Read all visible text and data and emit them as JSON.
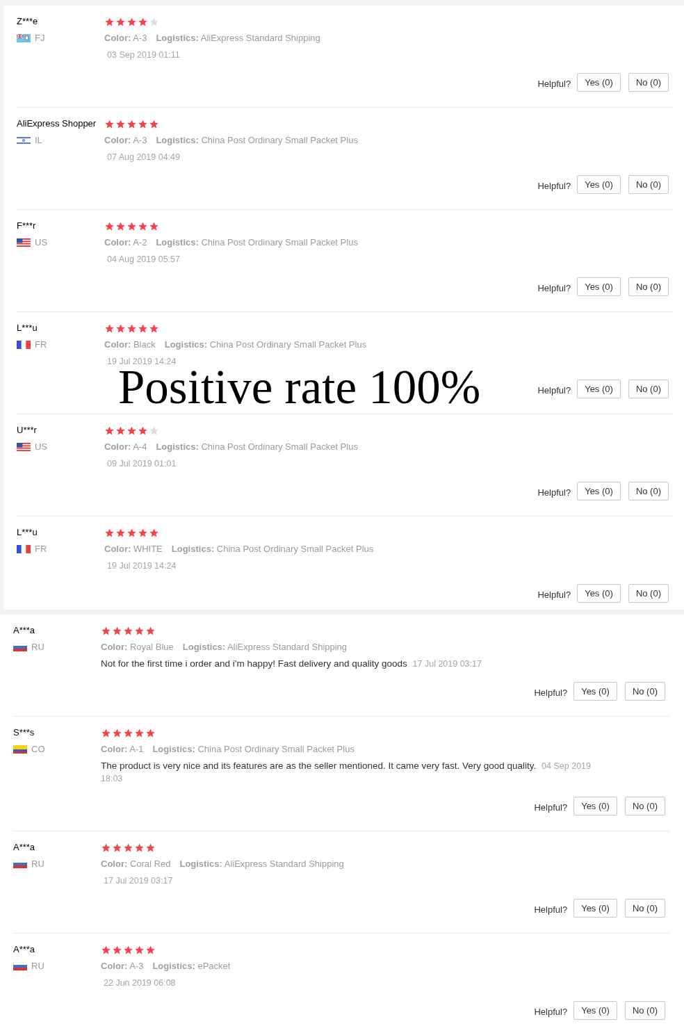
{
  "panels": [
    {
      "reviews": [
        {
          "name": "Z***e",
          "country": "FJ",
          "flag": {
            "kind": "fiji"
          },
          "stars": 4,
          "color_label": "Color:",
          "color_value": "A-3",
          "logistics_label": "Logistics:",
          "logistics_value": "AliExpress Standard Shipping",
          "date": "03 Sep 2019 01:11",
          "helpful_label": "Helpful?",
          "yes_button": "Yes (0)",
          "no_button": "No (0)"
        },
        {
          "name": "AliExpress Shopper",
          "country": "IL",
          "flag": {
            "kind": "israel"
          },
          "stars": 5,
          "color_label": "Color:",
          "color_value": "A-3",
          "logistics_label": "Logistics:",
          "logistics_value": "China Post Ordinary Small Packet Plus",
          "date": "07 Aug 2019 04:49",
          "helpful_label": "Helpful?",
          "yes_button": "Yes (0)",
          "no_button": "No (0)"
        },
        {
          "name": "F***r",
          "country": "US",
          "flag": {
            "kind": "usa"
          },
          "stars": 5,
          "color_label": "Color:",
          "color_value": "A-2",
          "logistics_label": "Logistics:",
          "logistics_value": "China Post Ordinary Small Packet Plus",
          "date": "04 Aug 2019 05:57",
          "helpful_label": "Helpful?",
          "yes_button": "Yes (0)",
          "no_button": "No (0)"
        },
        {
          "name": "L***u",
          "country": "FR",
          "flag": {
            "kind": "france"
          },
          "stars": 5,
          "color_label": "Color:",
          "color_value": "Black",
          "logistics_label": "Logistics:",
          "logistics_value": "China Post Ordinary Small Packet Plus",
          "date": "19 Jul 2019 14:24",
          "helpful_label": "Helpful?",
          "yes_button": "Yes (0)",
          "no_button": "No (0)"
        },
        {
          "name": "U***r",
          "country": "US",
          "flag": {
            "kind": "usa"
          },
          "stars": 4,
          "color_label": "Color:",
          "color_value": "A-4",
          "logistics_label": "Logistics:",
          "logistics_value": "China Post Ordinary Small Packet Plus",
          "date": "09 Jul 2019 01:01",
          "helpful_label": "Helpful?",
          "yes_button": "Yes (0)",
          "no_button": "No (0)"
        },
        {
          "name": "L***u",
          "country": "FR",
          "flag": {
            "kind": "france"
          },
          "stars": 5,
          "color_label": "Color:",
          "color_value": "WHITE",
          "logistics_label": "Logistics:",
          "logistics_value": "China Post Ordinary Small Packet Plus",
          "date": "19 Jul 2019 14:24",
          "helpful_label": "Helpful?",
          "yes_button": "Yes (0)",
          "no_button": "No (0)"
        }
      ]
    },
    {
      "reviews": [
        {
          "name": "A***a",
          "country": "RU",
          "flag": {
            "kind": "russia"
          },
          "stars": 5,
          "color_label": "Color:",
          "color_value": "Royal Blue",
          "logistics_label": "Logistics:",
          "logistics_value": "AliExpress Standard Shipping",
          "text": "Not for the first time i order and i'm happy! Fast delivery and quality goods",
          "date": "17 Jul 2019 03:17",
          "helpful_label": "Helpful?",
          "yes_button": "Yes (0)",
          "no_button": "No (0)"
        },
        {
          "name": "S***s",
          "country": "CO",
          "flag": {
            "kind": "colombia"
          },
          "stars": 5,
          "color_label": "Color:",
          "color_value": "A-1",
          "logistics_label": "Logistics:",
          "logistics_value": "China Post Ordinary Small Packet Plus",
          "text": "The product is very nice and its features are as the seller mentioned. It came very fast. Very good quality.",
          "date": "04 Sep 2019 18:03",
          "helpful_label": "Helpful?",
          "yes_button": "Yes (0)",
          "no_button": "No (0)"
        },
        {
          "name": "A***a",
          "country": "RU",
          "flag": {
            "kind": "russia"
          },
          "stars": 5,
          "color_label": "Color:",
          "color_value": "Coral Red",
          "logistics_label": "Logistics:",
          "logistics_value": "AliExpress Standard Shipping",
          "date": "17 Jul 2019 03:17",
          "helpful_label": "Helpful?",
          "yes_button": "Yes (0)",
          "no_button": "No (0)"
        },
        {
          "name": "A***a",
          "country": "RU",
          "flag": {
            "kind": "russia"
          },
          "stars": 5,
          "color_label": "Color:",
          "color_value": "A-3",
          "logistics_label": "Logistics:",
          "logistics_value": "ePacket",
          "date": "22 Jun 2019 06:08",
          "helpful_label": "Helpful?",
          "yes_button": "Yes (0)",
          "no_button": "No (0)"
        }
      ]
    }
  ],
  "overlay_caption": "Positive rate 100%"
}
